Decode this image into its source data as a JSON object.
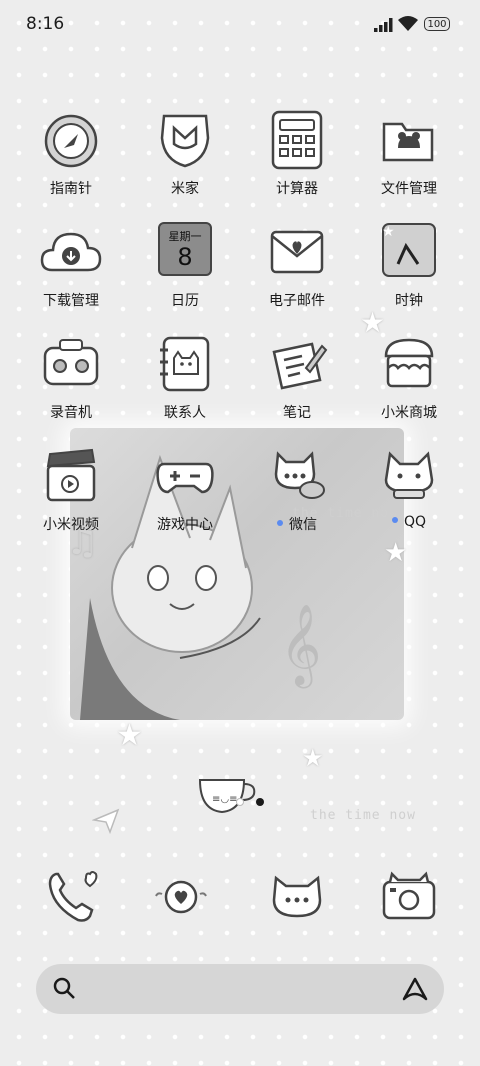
{
  "status_bar": {
    "time": "8:16",
    "battery": "100"
  },
  "apps": [
    {
      "label": "指南针",
      "icon": "compass-icon"
    },
    {
      "label": "米家",
      "icon": "mijia-icon"
    },
    {
      "label": "计算器",
      "icon": "calculator-icon"
    },
    {
      "label": "文件管理",
      "icon": "folder-icon"
    },
    {
      "label": "下载管理",
      "icon": "cloud-download-icon"
    },
    {
      "label": "日历",
      "icon": "calendar-icon",
      "weekday": "星期一",
      "day": "8"
    },
    {
      "label": "电子邮件",
      "icon": "envelope-icon"
    },
    {
      "label": "时钟",
      "icon": "clock-icon"
    },
    {
      "label": "录音机",
      "icon": "tape-recorder-icon"
    },
    {
      "label": "联系人",
      "icon": "contacts-book-icon"
    },
    {
      "label": "笔记",
      "icon": "notes-pencil-icon"
    },
    {
      "label": "小米商城",
      "icon": "store-icon"
    },
    {
      "label": "小米视频",
      "icon": "clapperboard-icon"
    },
    {
      "label": "游戏中心",
      "icon": "gamepad-icon"
    },
    {
      "label": "微信",
      "icon": "wechat-chat-icon",
      "badge": true
    },
    {
      "label": "QQ",
      "icon": "qq-cat-icon",
      "badge": true
    }
  ],
  "wallpaper": {
    "watermark_text": "the time now"
  },
  "pager": {
    "total": 2,
    "active": 1
  },
  "dock": [
    {
      "icon": "phone-icon"
    },
    {
      "icon": "heart-bubble-icon"
    },
    {
      "icon": "message-bubble-icon"
    },
    {
      "icon": "camera-icon"
    }
  ],
  "colors": {
    "background": "#ededed",
    "badge": "#5b8bf0",
    "icon_stroke": "#444444"
  }
}
